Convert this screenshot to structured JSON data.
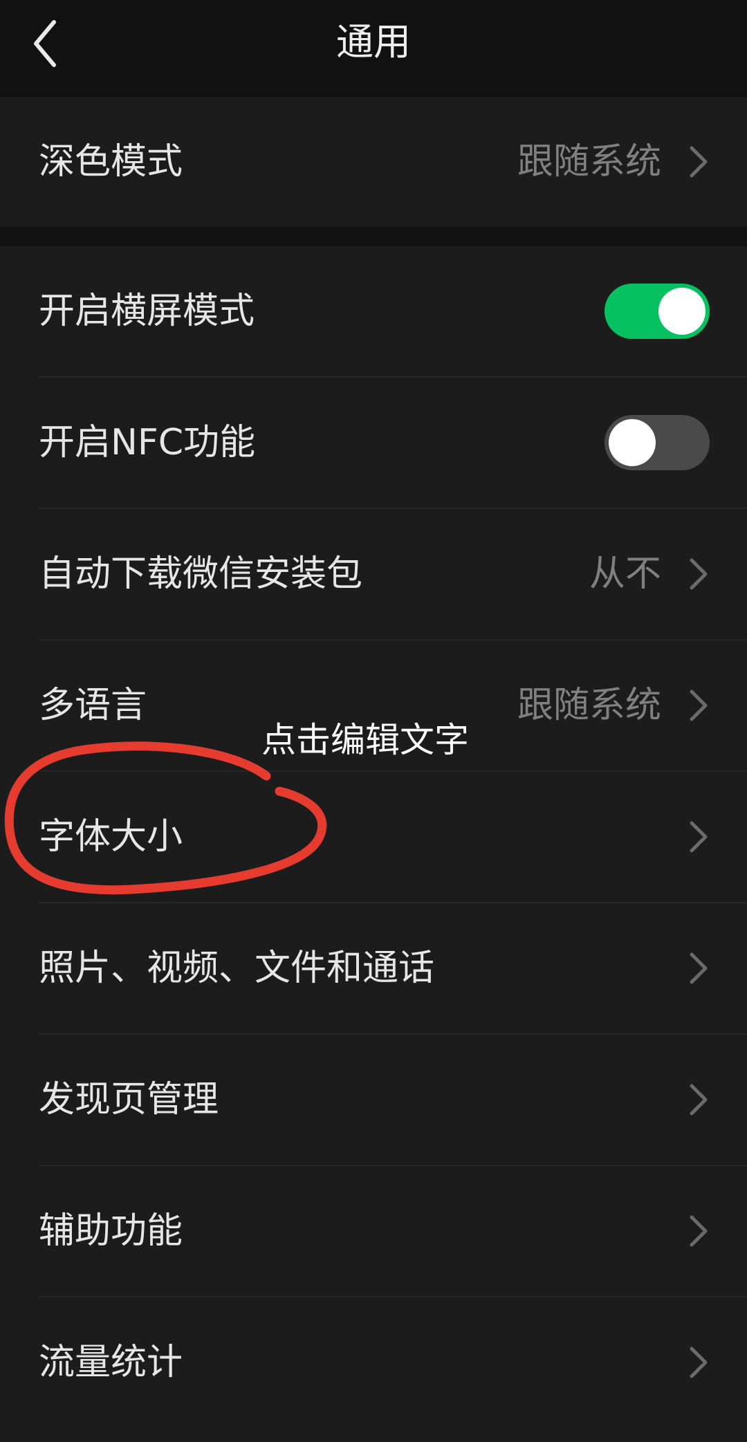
{
  "header": {
    "title": "通用",
    "back_icon": "chevron-left-icon"
  },
  "sections": [
    {
      "rows": [
        {
          "label": "深色模式",
          "value": "跟随系统",
          "type": "link"
        }
      ]
    },
    {
      "rows": [
        {
          "label": "开启横屏模式",
          "type": "toggle",
          "toggle_on": true
        },
        {
          "label": "开启NFC功能",
          "type": "toggle",
          "toggle_on": false
        },
        {
          "label": "自动下载微信安装包",
          "value": "从不",
          "type": "link"
        },
        {
          "label": "多语言",
          "value": "跟随系统",
          "type": "link"
        },
        {
          "label": "字体大小",
          "value": "",
          "type": "link"
        },
        {
          "label": "照片、视频、文件和通话",
          "value": "",
          "type": "link"
        },
        {
          "label": "发现页管理",
          "value": "",
          "type": "link"
        },
        {
          "label": "辅助功能",
          "value": "",
          "type": "link"
        },
        {
          "label": "流量统计",
          "value": "",
          "type": "link"
        }
      ]
    }
  ],
  "annotation": {
    "text": "点击编辑文字",
    "circle_color": "#e53c2f"
  },
  "colors": {
    "background": "#111111",
    "cell_background": "#1c1c1c",
    "toggle_on": "#07c160",
    "toggle_off": "#4a4a4a",
    "secondary_text": "#808080"
  }
}
